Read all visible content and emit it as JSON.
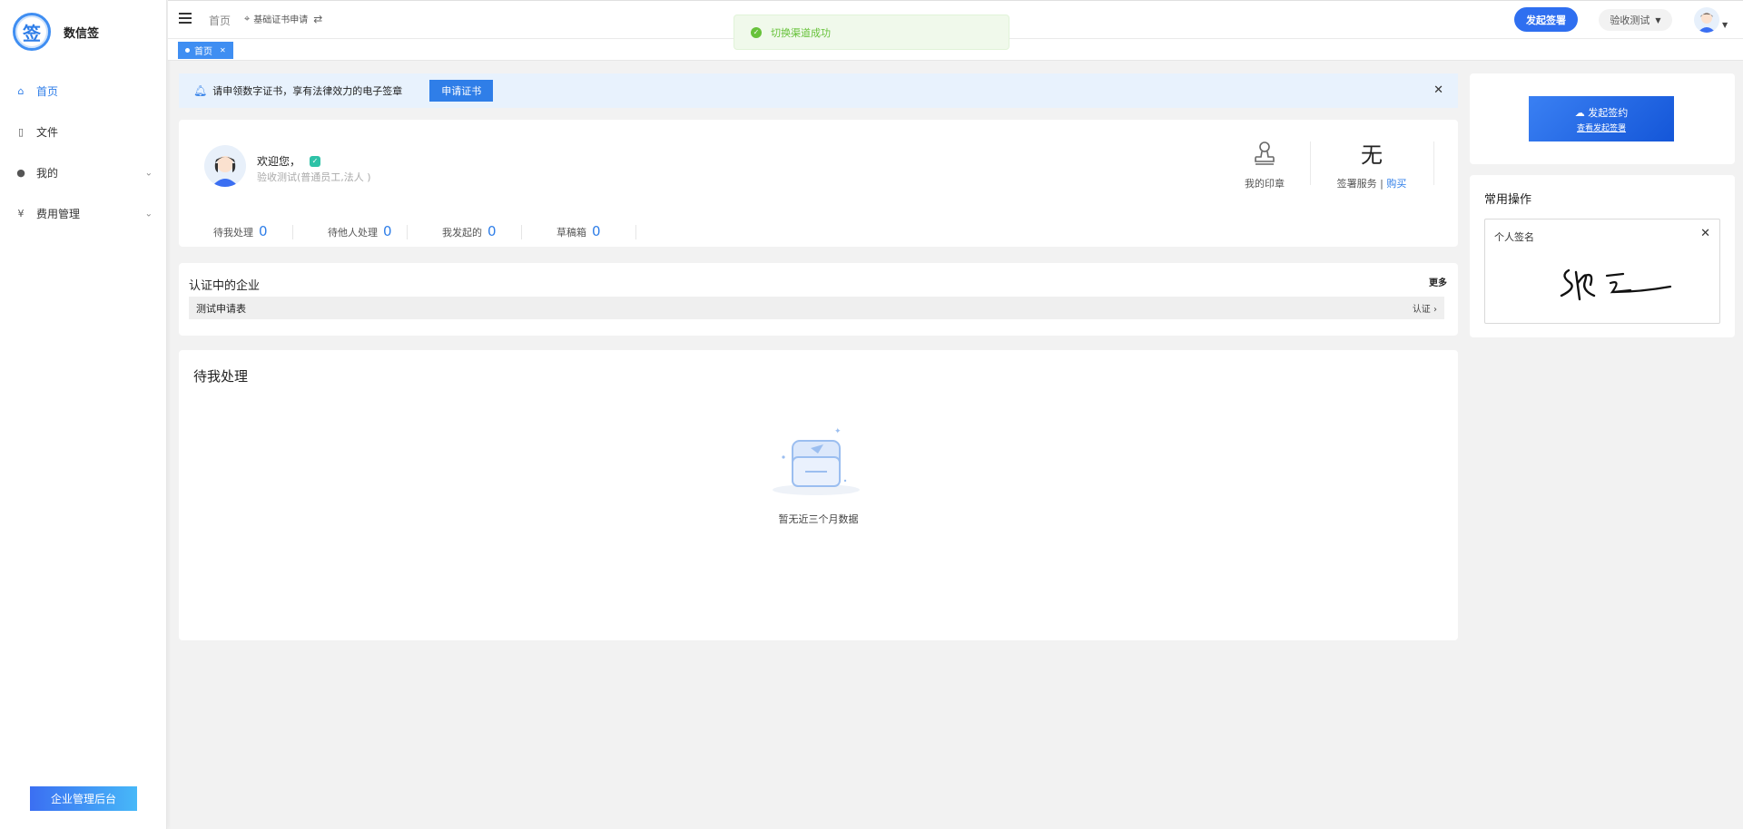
{
  "app": {
    "name": "数信签",
    "logo_char": "签"
  },
  "sidebar": {
    "items": [
      {
        "label": "首页",
        "icon": "home-icon",
        "active": true
      },
      {
        "label": "文件",
        "icon": "file-icon",
        "active": false
      },
      {
        "label": "我的",
        "icon": "user-icon",
        "active": false,
        "expandable": true
      },
      {
        "label": "费用管理",
        "icon": "yen-icon",
        "active": false,
        "expandable": true
      }
    ],
    "admin_button": "企业管理后台"
  },
  "header": {
    "breadcrumb_home": "首页",
    "location": "基础证书申请",
    "launch_button": "发起签署",
    "user_name": "验收测试",
    "tab": "首页"
  },
  "toast": {
    "text": "切换渠道成功"
  },
  "notice": {
    "text": "请申领数字证书，享有法律效力的电子签章",
    "button": "申请证书"
  },
  "welcome": {
    "greeting": "欢迎您，",
    "subtitle": "验收测试(普通员工,法人 )",
    "stats": [
      {
        "label": "待我处理",
        "value": "0"
      },
      {
        "label": "待他人处理",
        "value": "0"
      },
      {
        "label": "我发起的",
        "value": "0"
      },
      {
        "label": "草稿箱",
        "value": "0"
      }
    ],
    "seal_label": "我的印章",
    "service_value": "无",
    "service_label": "签署服务 | ",
    "buy_label": "购买"
  },
  "enterprise": {
    "title": "认证中的企业",
    "more": "更多",
    "row_name": "测试申请表",
    "row_action": "认证"
  },
  "todo": {
    "title": "待我处理",
    "empty_text": "暂无近三个月数据"
  },
  "right": {
    "launch_label": "发起签约",
    "launch_sub": "查看发起签署",
    "ops_title": "常用操作",
    "signature_label": "个人签名"
  },
  "colors": {
    "accent": "#2f7ee8",
    "success": "#67c23a"
  }
}
